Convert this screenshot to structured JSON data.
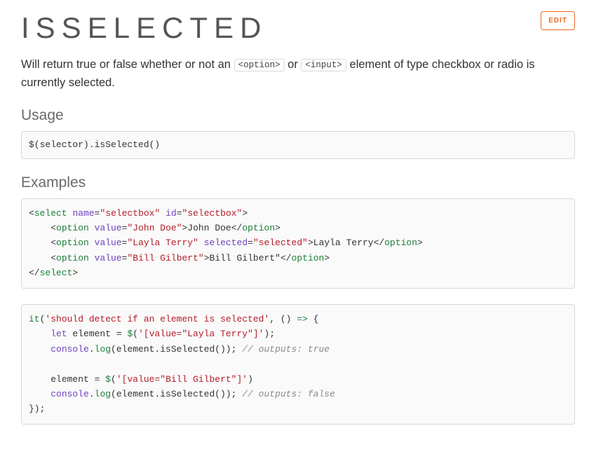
{
  "header": {
    "title": "ISSELECTED",
    "edit_label": "EDIT"
  },
  "description": {
    "part1": "Will return true or false whether or not an ",
    "code1": "<option>",
    "part2": " or ",
    "code2": "<input>",
    "part3": " element of type checkbox or radio is currently selected."
  },
  "sections": {
    "usage": "Usage",
    "examples": "Examples"
  },
  "usage_code": {
    "line1": "$(selector).isSelected()"
  },
  "examples_code1": {
    "l1_open": "<",
    "l1_tag": "select",
    "l1_sp1": " ",
    "l1_attr1": "name",
    "l1_eq": "=",
    "l1_val1": "\"selectbox\"",
    "l1_sp2": " ",
    "l1_attr2": "id",
    "l1_val2": "\"selectbox\"",
    "l1_close": ">",
    "l2_indent": "    ",
    "l2_open": "<",
    "l2_tag": "option",
    "l2_sp": " ",
    "l2_attr": "value",
    "l2_eq": "=",
    "l2_val": "\"John Doe\"",
    "l2_close": ">",
    "l2_text": "John Doe",
    "l2_endopen": "</",
    "l2_endtag": "option",
    "l2_endclose": ">",
    "l3_indent": "    ",
    "l3_open": "<",
    "l3_tag": "option",
    "l3_sp": " ",
    "l3_attr": "value",
    "l3_eq": "=",
    "l3_val": "\"Layla Terry\"",
    "l3_sp2": " ",
    "l3_attr2": "selected",
    "l3_val2": "\"selected\"",
    "l3_close": ">",
    "l3_text": "Layla Terry",
    "l3_endopen": "</",
    "l3_endtag": "option",
    "l3_endclose": ">",
    "l4_indent": "    ",
    "l4_open": "<",
    "l4_tag": "option",
    "l4_sp": " ",
    "l4_attr": "value",
    "l4_eq": "=",
    "l4_val": "\"Bill Gilbert\"",
    "l4_close": ">",
    "l4_text": "Bill Gilbert\"",
    "l4_endopen": "</",
    "l4_endtag": "option",
    "l4_endclose": ">",
    "l5_open": "</",
    "l5_tag": "select",
    "l5_close": ">"
  },
  "examples_code2": {
    "l1_a": "it",
    "l1_b": "(",
    "l1_c": "'should detect if an element is selected'",
    "l1_d": ", () ",
    "l1_e": "=>",
    "l1_f": " {",
    "l2_indent": "    ",
    "l2_a": "let",
    "l2_b": " element = ",
    "l2_c": "$",
    "l2_d": "(",
    "l2_e": "'[value=\"Layla Terry\"]'",
    "l2_f": ");",
    "l3_indent": "    ",
    "l3_a": "console",
    "l3_b": ".",
    "l3_c": "log",
    "l3_d": "(element.isSelected()); ",
    "l3_cmt": "// outputs: true",
    "l4_blank": "",
    "l5_indent": "    ",
    "l5_a": "element = ",
    "l5_b": "$",
    "l5_c": "(",
    "l5_d": "'[value=\"Bill Gilbert\"]'",
    "l5_e": ")",
    "l6_indent": "    ",
    "l6_a": "console",
    "l6_b": ".",
    "l6_c": "log",
    "l6_d": "(element.isSelected()); ",
    "l6_cmt": "// outputs: false",
    "l7": "});"
  }
}
